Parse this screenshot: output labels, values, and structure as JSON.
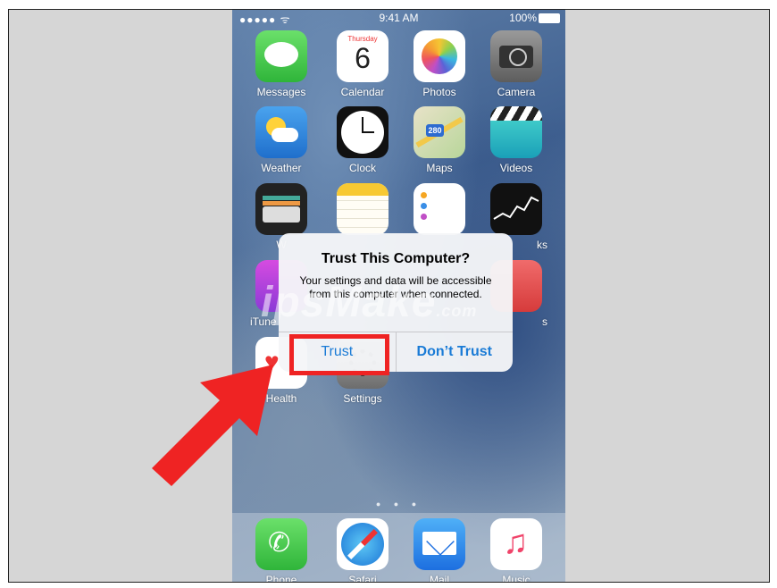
{
  "status": {
    "signal": "●●●●● ᯤ",
    "time": "9:41 AM",
    "battery": "100%"
  },
  "apps": [
    {
      "name": "messages",
      "label": "Messages"
    },
    {
      "name": "calendar",
      "label": "Calendar",
      "day": "Thursday",
      "date": "6"
    },
    {
      "name": "photos",
      "label": "Photos"
    },
    {
      "name": "camera",
      "label": "Camera"
    },
    {
      "name": "weather",
      "label": "Weather"
    },
    {
      "name": "clock",
      "label": "Clock"
    },
    {
      "name": "maps",
      "label": "Maps",
      "shield": "280"
    },
    {
      "name": "videos",
      "label": "Videos"
    },
    {
      "name": "wallet",
      "label": "W"
    },
    {
      "name": "notes",
      "label": ""
    },
    {
      "name": "reminders",
      "label": ""
    },
    {
      "name": "stocks",
      "label": "ks"
    },
    {
      "name": "itunes",
      "label": "iTune"
    },
    {
      "name": "ibooks",
      "label": "s"
    },
    {
      "name": "health",
      "label": "Health"
    },
    {
      "name": "settings",
      "label": "Settings"
    }
  ],
  "dock": [
    {
      "name": "phone",
      "label": "Phone"
    },
    {
      "name": "safari",
      "label": "Safari"
    },
    {
      "name": "mail",
      "label": "Mail"
    },
    {
      "name": "music",
      "label": "Music"
    }
  ],
  "alert": {
    "title": "Trust This Computer?",
    "message": "Your settings and data will be accessible from this computer when connected.",
    "trust_label": "Trust",
    "dont_trust_label": "Don’t Trust"
  },
  "watermark": {
    "main": "ipsMake",
    "suffix": ".com"
  },
  "colors": {
    "highlight": "#ef2323",
    "link": "#1a7bd6"
  }
}
